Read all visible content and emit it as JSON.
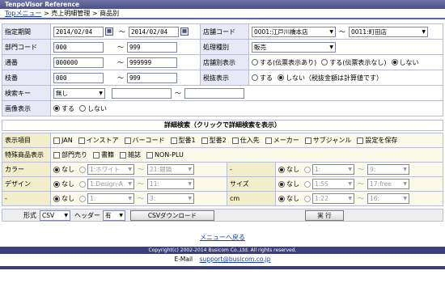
{
  "app_title": "TenpoVisor Reference",
  "breadcrumb": {
    "top": "Topメニュー",
    "sep1": ">",
    "mid": "売上明細管理",
    "sep2": ">",
    "current": "商品別"
  },
  "form": {
    "period": {
      "label": "指定期間",
      "from": "2014/02/04",
      "to": "2014/02/04",
      "tilde": "～"
    },
    "store": {
      "label": "店舗コード",
      "from": "0001:江戸川橋本店",
      "to": "0011:町田店"
    },
    "dept": {
      "label": "部門コード",
      "from": "000",
      "to": "999"
    },
    "proc": {
      "label": "処理種別",
      "value": "販売"
    },
    "tsuban": {
      "label": "通番",
      "from": "000000",
      "to": "999999"
    },
    "store_show": {
      "label": "店舗別表示",
      "opt1": "する(伝票表示あり)",
      "opt2": "する(伝票表示なし)",
      "opt3": "しない",
      "selected": "opt3"
    },
    "kaban": {
      "label": "枝番",
      "from": "000",
      "to": "999"
    },
    "tax": {
      "label": "税抜表示",
      "opt1": "する",
      "opt2": "しない（税抜金額は計算値です）",
      "selected": "opt2"
    },
    "search_key": {
      "label": "検索キー",
      "value": "無し",
      "from": "",
      "to": ""
    },
    "image": {
      "label": "画像表示",
      "opt1": "する",
      "opt2": "しない",
      "selected": "opt1"
    }
  },
  "detail_bar": "詳細検索（クリックで詳細検索を表示）",
  "detail": {
    "items_label": "表示項目",
    "items": [
      "JAN",
      "インストア",
      "バーコード",
      "型番1",
      "型番2",
      "仕入先",
      "メーカー",
      "サブジャンル",
      "設定を保存"
    ],
    "special_label": "特殊商品表示",
    "special": [
      "部門売り",
      "書籍",
      "雑誌",
      "NON-PLU"
    ],
    "none": "なし",
    "rows": [
      {
        "label": "カラー",
        "from": "1:ホワイト",
        "to": "21:銀鍋",
        "label2": "-",
        "from2": "1:",
        "to2": "9:"
      },
      {
        "label": "デザイン",
        "from": "1:Design-A",
        "to": "11:",
        "label2": "サイズ",
        "from2": "1:SS",
        "to2": "17:free"
      },
      {
        "label": "-",
        "from": "1:",
        "to": "3:",
        "label2": "cm",
        "from2": "1:22",
        "to2": "16:"
      }
    ]
  },
  "actions": {
    "format_label": "形式",
    "format_value": "CSV",
    "header_label": "ヘッダー",
    "header_value": "有",
    "csv_button": "CSVダウンロード",
    "run_button": "実 行"
  },
  "menu_link": "メニューへ戻る",
  "copyright": "Copyright(c) 2002-2014 Busicom Co.,Ltd. All rights reserved.",
  "email_label": "E-Mail",
  "email": "support@busicom.co.jp"
}
